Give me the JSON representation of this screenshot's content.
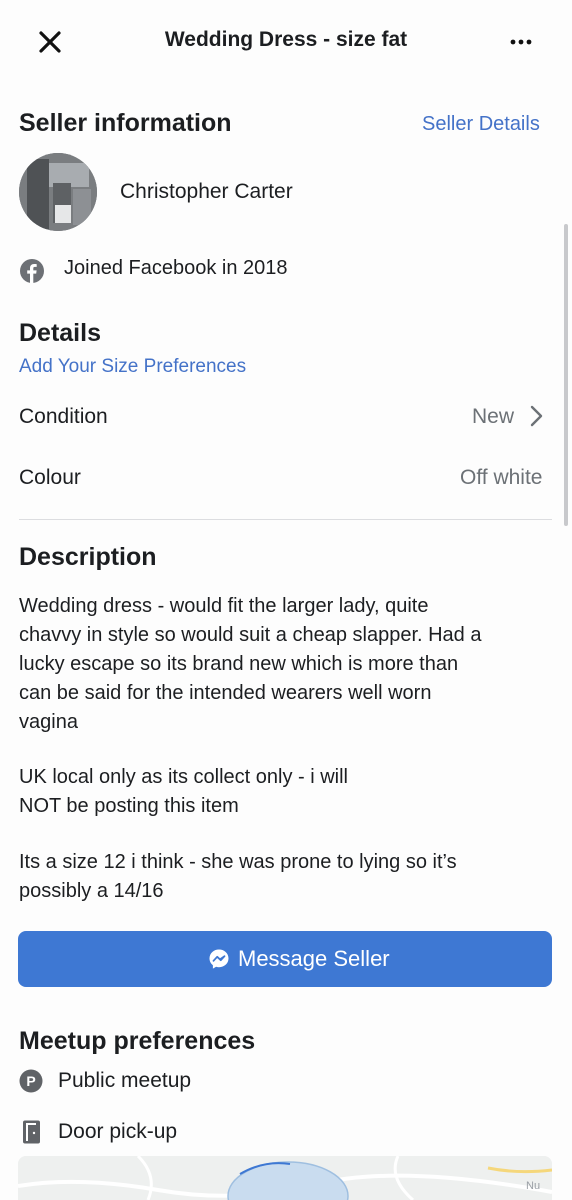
{
  "header": {
    "title": "Wedding Dress - size fat"
  },
  "seller_info": {
    "heading": "Seller information",
    "details_link": "Seller Details",
    "name": "Christopher Carter",
    "joined": "Joined Facebook in 2018"
  },
  "details": {
    "heading": "Details",
    "size_link": "Add Your Size Preferences",
    "rows": [
      {
        "label": "Condition",
        "value": "New"
      },
      {
        "label": "Colour",
        "value": "Off white"
      }
    ]
  },
  "description": {
    "heading": "Description",
    "paragraphs": [
      [
        "Wedding dress - would fit the larger lady, quite",
        "chavvy in style so would suit a cheap slapper. Had a",
        "lucky escape so its brand new which is more than",
        "can be said for the intended wearers well worn",
        "vagina"
      ],
      [
        "UK local only as its collect only - i will",
        "NOT be posting this item"
      ],
      [
        "Its a size 12 i think - she was prone to lying so it’s",
        "possibly a 14/16"
      ]
    ]
  },
  "message_button": {
    "label": "Message Seller"
  },
  "meetup": {
    "heading": "Meetup preferences",
    "items": [
      {
        "label": "Public meetup",
        "icon": "public-meetup-icon"
      },
      {
        "label": "Door pick-up",
        "icon": "door-icon"
      }
    ]
  },
  "map": {
    "corner_label": "Nu"
  },
  "colors": {
    "link": "#4472c8",
    "button": "#3e78d3",
    "muted_text": "#6c7176"
  }
}
